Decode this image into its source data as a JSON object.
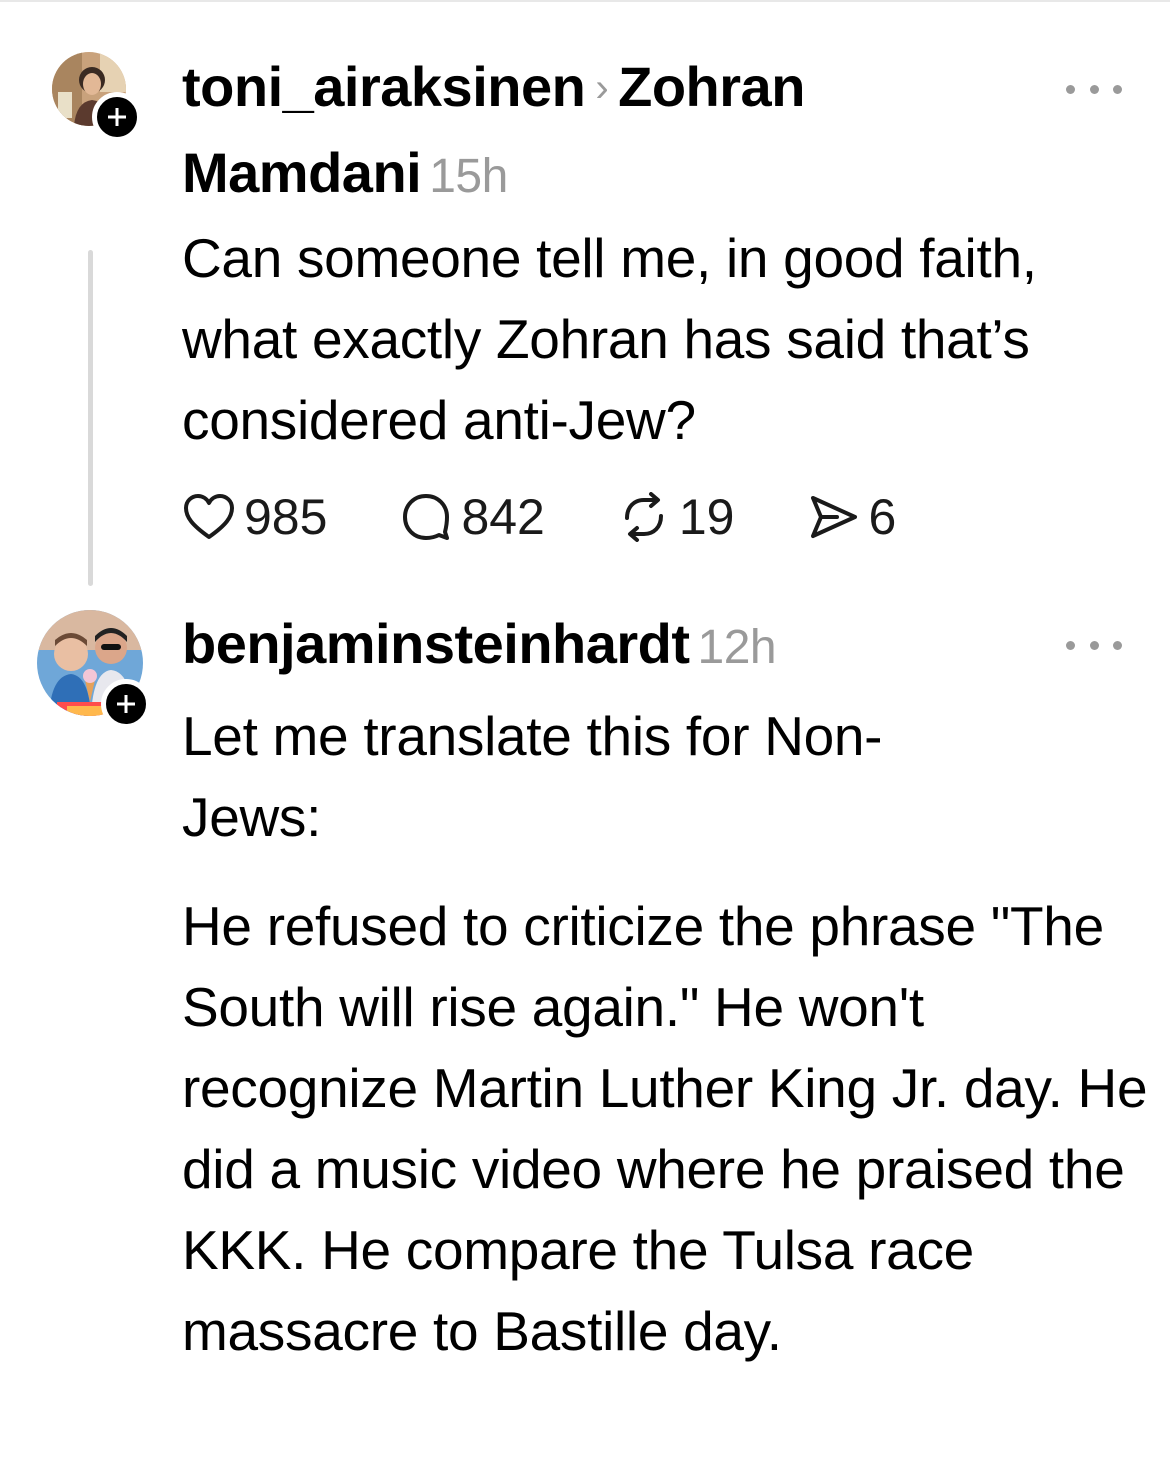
{
  "posts": [
    {
      "username": "toni_airaksinen",
      "reply_target": "Zohran",
      "reply_target_cont": "Mamdani",
      "separator": "›",
      "time": "15h",
      "text": "Can someone tell me, in good faith, what exactly Zohran has said that’s considered anti-Jew?",
      "stats": {
        "likes": "985",
        "comments": "842",
        "reposts": "19",
        "shares": "6"
      }
    },
    {
      "username": "benjaminsteinhardt",
      "time": "12h",
      "text_para1": "Let me translate this for Non-\nJews:",
      "text_para2": "He refused to criticize the phrase \"The South will rise again.\" He won't recognize Martin Luther King Jr. day. He did a music video where he praised the KKK. He compare the Tulsa race massacre to Bastille day."
    }
  ],
  "icons": {
    "like": "heart-icon",
    "comment": "comment-icon",
    "repost": "repost-icon",
    "share": "send-icon",
    "more": "more-icon",
    "follow": "plus-icon"
  },
  "colors": {
    "text": "#000000",
    "muted": "#9a9a9a",
    "thread_line": "#d9d9d9",
    "background": "#ffffff"
  }
}
